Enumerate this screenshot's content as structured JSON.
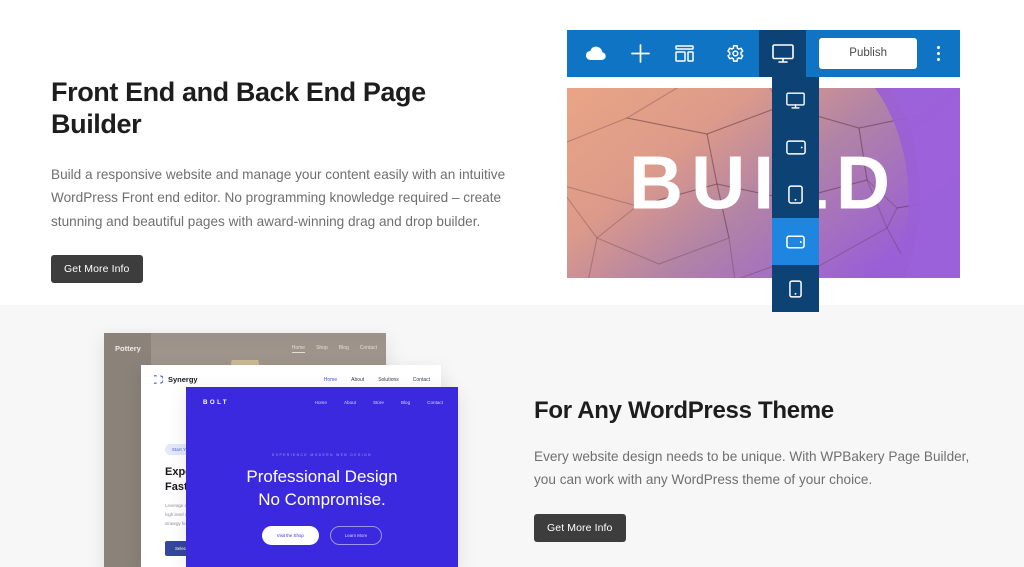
{
  "section_one": {
    "headline": "Front End and Back End Page Builder",
    "body": "Build a responsive website and manage your content easily with an intuitive WordPress Front end editor. No programming knowledge required – create stunning and beautiful pages with award-winning drag and drop builder.",
    "cta_label": "Get More Info"
  },
  "editor": {
    "toolbar": {
      "logo_icon": "cloud-logo-icon",
      "add_icon": "plus-icon",
      "layout_icon": "layout-grid-icon",
      "settings_icon": "gear-icon",
      "preview_icon": "desktop-monitor-icon",
      "publish_label": "Publish",
      "more_icon": "vertical-dots-icon",
      "bar_color": "#1074C4",
      "active_color": "#0D4374"
    },
    "device_rail": {
      "active_color": "#1E86E0",
      "rail_color": "#0D4374",
      "items": [
        {
          "name": "desktop",
          "icon": "desktop-monitor-icon",
          "active": false
        },
        {
          "name": "tablet-landscape",
          "icon": "tablet-landscape-icon",
          "active": false
        },
        {
          "name": "tablet-portrait",
          "icon": "tablet-portrait-icon",
          "active": false
        },
        {
          "name": "mobile-landscape",
          "icon": "mobile-landscape-icon",
          "active": true
        },
        {
          "name": "mobile-portrait",
          "icon": "mobile-portrait-icon",
          "active": false
        }
      ]
    },
    "canvas": {
      "hero_word": "BUILD"
    }
  },
  "section_two": {
    "headline": "For Any WordPress Theme",
    "body": "Every website design needs to be unique. With WPBakery Page Builder, you can work with any WordPress theme of your choice.",
    "cta_label": "Get More Info"
  },
  "mockups": {
    "pottery": {
      "logo": "Pottery",
      "nav": [
        "Home",
        "Shop",
        "Blog",
        "Contact"
      ],
      "active_nav": "Home"
    },
    "synergy": {
      "logo": "Synergy",
      "logo_icon": "synergy-mark-icon",
      "nav": [
        "Home",
        "About",
        "Solutions",
        "Contact"
      ],
      "active_nav": "Home",
      "badge": "Start Your Free Trial",
      "heading_line1": "Experience",
      "heading_line2": "Fast & Reliable",
      "body": "Leverage agile frameworks to provide a robust synopsis for high level overviews. Iterative approaches to corporate strategy foster collaboration to further the overall value.",
      "cta_label": "Select a Plan"
    },
    "bolt": {
      "logo": "BOLT",
      "nav": [
        "Home",
        "About",
        "Store",
        "Blog",
        "Contact"
      ],
      "eyebrow": "EXPERIENCE MODERN WEB DESIGN",
      "heading_line1": "Professional Design",
      "heading_line2": "No Compromise.",
      "primary_cta": "Visit the Shop",
      "secondary_cta": "Learn More"
    }
  },
  "theme": {
    "section_one_bg": "#FFFFFF",
    "section_two_bg": "#F7F7F7",
    "button_bg": "#3D3D3D",
    "heading_color": "#1D1D1D",
    "body_color": "#6F6F6F"
  }
}
